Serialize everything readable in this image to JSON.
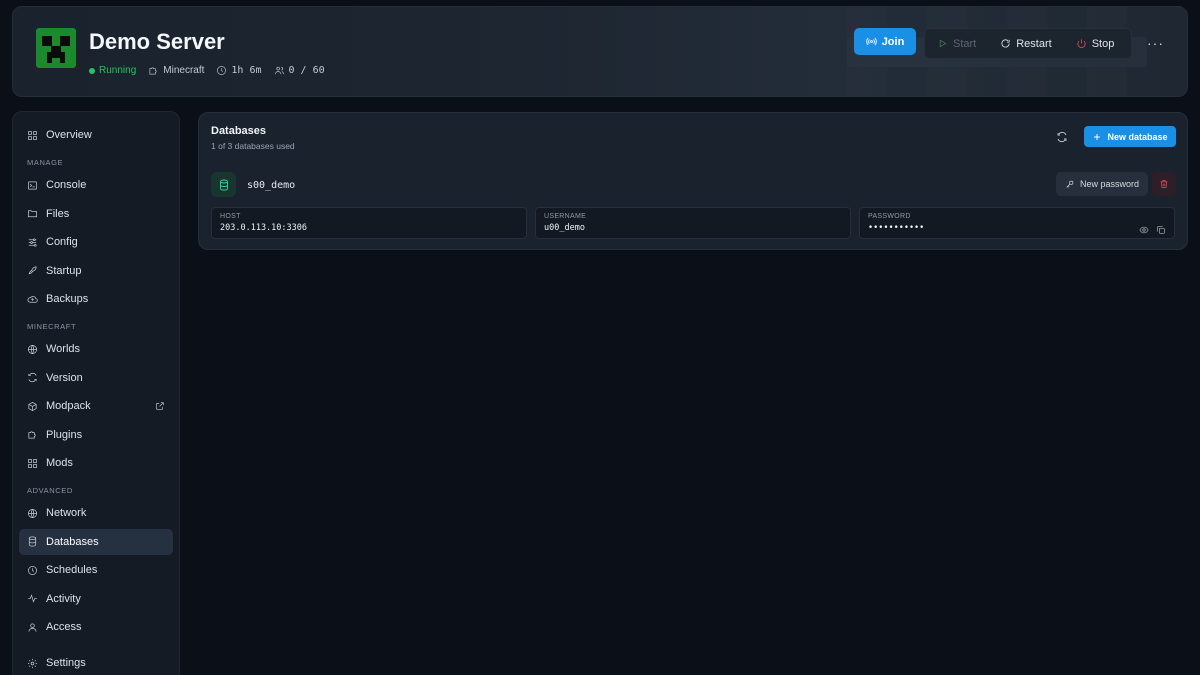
{
  "header": {
    "title": "Demo Server",
    "status": "Running",
    "game": "Minecraft",
    "uptime": "1h 6m",
    "players": "0 / 60",
    "join_label": "Join",
    "start_label": "Start",
    "restart_label": "Restart",
    "stop_label": "Stop",
    "more_label": "···"
  },
  "sidebar": {
    "overview": "Overview",
    "sections": {
      "manage": "MANAGE",
      "minecraft": "MINECRAFT",
      "advanced": "ADVANCED"
    },
    "manage_items": [
      "Console",
      "Files",
      "Config",
      "Startup",
      "Backups"
    ],
    "minecraft_items": [
      "Worlds",
      "Version",
      "Modpack",
      "Plugins",
      "Mods"
    ],
    "advanced_items": [
      "Network",
      "Databases",
      "Schedules",
      "Activity",
      "Access"
    ],
    "settings": "Settings",
    "active": "Databases"
  },
  "databases": {
    "title": "Databases",
    "subtitle": "1 of 3 databases used",
    "new_database_label": "New database",
    "items": [
      {
        "name": "s00_demo",
        "new_password_label": "New password",
        "host_label": "HOST",
        "host": "203.0.113.10:3306",
        "username_label": "USERNAME",
        "username": "u00_demo",
        "password_label": "PASSWORD",
        "password": "•••••••••••"
      }
    ]
  },
  "colors": {
    "accent": "#1a8fe6",
    "running": "#22c55e",
    "danger": "#e5485f",
    "db_icon": "#2dd4a3"
  }
}
